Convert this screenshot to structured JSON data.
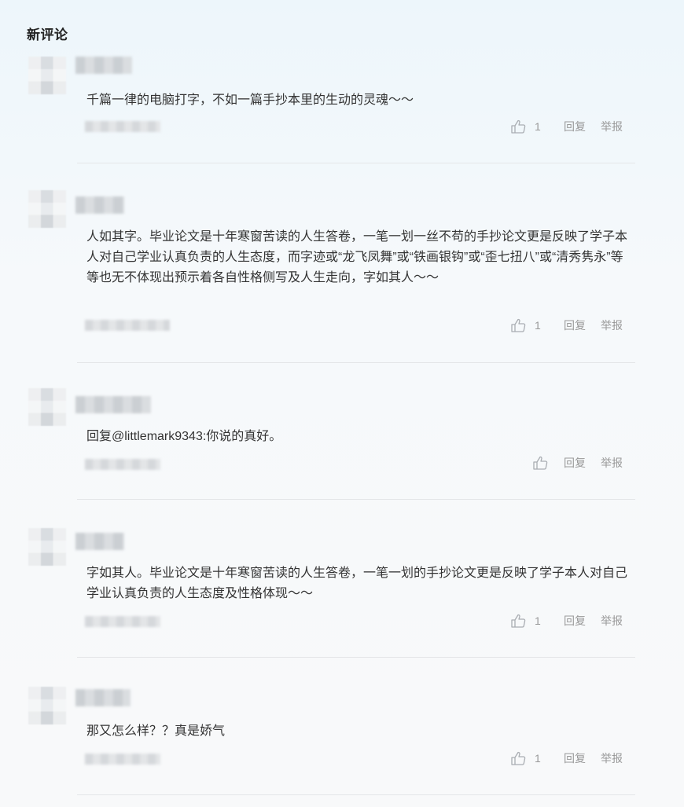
{
  "section": {
    "title": "新评论"
  },
  "comments": [
    {
      "text": "千篇一律的电脑打字，不如一篇手抄本里的生动的灵魂～～",
      "likes": "1",
      "reply_label": "回复",
      "report_label": "举报"
    },
    {
      "text": "人如其字。毕业论文是十年寒窗苦读的人生答卷，一笔一划一丝不苟的手抄论文更是反映了学子本人对自己学业认真负责的人生态度，而字迹或“龙飞凤舞”或“铁画银钩”或“歪七扭八”或“清秀隽永”等等也无不体现出预示着各自性格侧写及人生走向，字如其人～～",
      "likes": "1",
      "reply_label": "回复",
      "report_label": "举报"
    },
    {
      "text": "回复@littlemark9343:你说的真好。",
      "likes": "",
      "reply_label": "回复",
      "report_label": "举报"
    },
    {
      "text": "字如其人。毕业论文是十年寒窗苦读的人生答卷，一笔一划的手抄论文更是反映了学子本人对自己学业认真负责的人生态度及性格体现～～",
      "likes": "1",
      "reply_label": "回复",
      "report_label": "举报"
    },
    {
      "text": "那又怎么样？？真是娇气",
      "likes": "1",
      "reply_label": "回复",
      "report_label": "举报"
    }
  ],
  "icons": {
    "like": "thumbs-up-icon"
  }
}
